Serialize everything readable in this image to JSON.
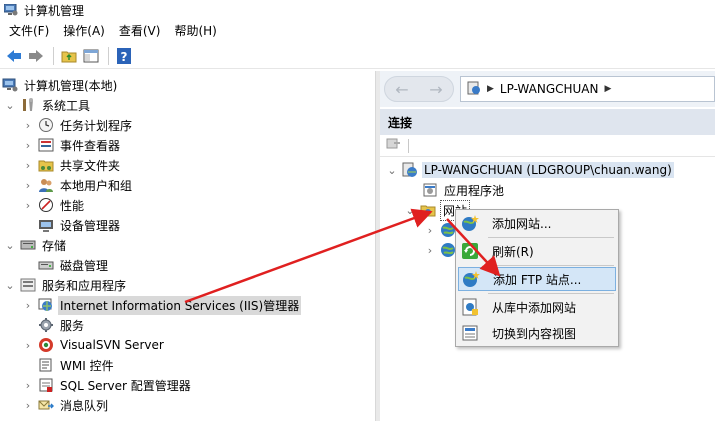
{
  "window": {
    "title": "计算机管理"
  },
  "menu": [
    "文件(F)",
    "操作(A)",
    "查看(V)",
    "帮助(H)"
  ],
  "left_tree": {
    "root": "计算机管理(本地)",
    "system_tools": "系统工具",
    "task_scheduler": "任务计划程序",
    "event_viewer": "事件查看器",
    "shared_folders": "共享文件夹",
    "local_users": "本地用户和组",
    "performance": "性能",
    "device_manager": "设备管理器",
    "storage": "存储",
    "disk_management": "磁盘管理",
    "services_apps": "服务和应用程序",
    "iis_manager": "Internet Information Services (IIS)管理器",
    "services": "服务",
    "visualsvn": "VisualSVN Server",
    "wmi": "WMI 控件",
    "sql_config": "SQL Server 配置管理器",
    "message_queue": "消息队列"
  },
  "address": {
    "crumb": "LP-WANGCHUAN"
  },
  "connections": {
    "header": "连接",
    "server": "LP-WANGCHUAN (LDGROUP\\chuan.wang)",
    "app_pools": "应用程序池",
    "sites": "网站"
  },
  "context_menu": {
    "add_website": "添加网站...",
    "refresh": "刷新(R)",
    "add_ftp": "添加 FTP 站点...",
    "add_from_gallery": "从库中添加网站",
    "switch_content": "切换到内容视图"
  },
  "colors": {
    "arrow": "#e02020",
    "highlight": "#d4e6f7",
    "header_bg": "#dfe5ee"
  }
}
